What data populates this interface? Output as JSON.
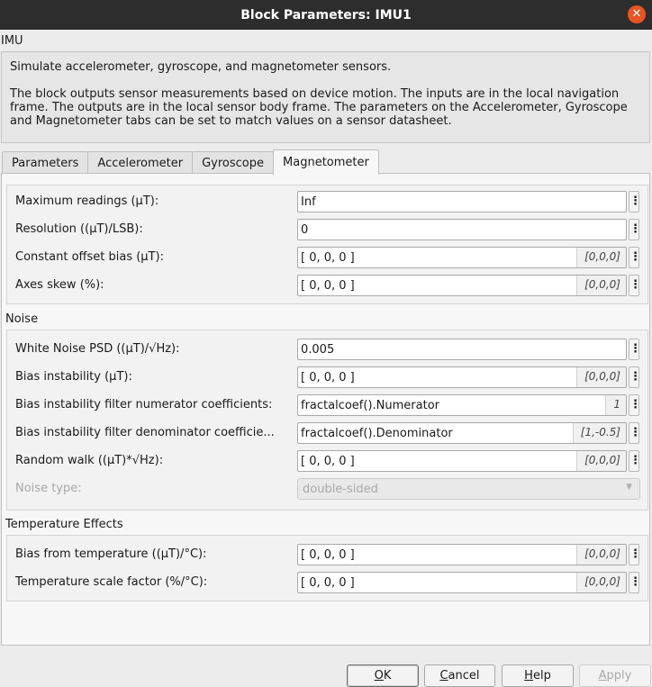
{
  "window": {
    "title": "Block Parameters: IMU1",
    "close_glyph": "✕"
  },
  "block_name": "IMU",
  "description": {
    "line1": "Simulate accelerometer, gyroscope, and magnetometer sensors.",
    "line2": "The block outputs sensor measurements based on device motion. The inputs are in the local navigation frame. The outputs are in the local sensor body frame. The parameters on the Accelerometer, Gyroscope and Magnetometer tabs can be set to match values on a sensor datasheet."
  },
  "tabs": [
    {
      "label": "Parameters"
    },
    {
      "label": "Accelerometer"
    },
    {
      "label": "Gyroscope"
    },
    {
      "label": "Magnetometer"
    }
  ],
  "sensor_group": {
    "max_readings": {
      "label": "Maximum readings (μT):",
      "value": "Inf"
    },
    "resolution": {
      "label": "Resolution ((μT)/LSB):",
      "value": "0"
    },
    "constant_offset": {
      "label": "Constant offset bias (μT):",
      "value": "[ 0, 0, 0 ]",
      "hint": "[0,0,0]"
    },
    "axes_skew": {
      "label": "Axes skew (%):",
      "value": "[ 0, 0, 0 ]",
      "hint": "[0,0,0]"
    }
  },
  "noise": {
    "title": "Noise",
    "white_noise": {
      "label": "White Noise PSD ((μT)/√Hz):",
      "value": "0.005"
    },
    "bias_instability": {
      "label": "Bias instability (μT):",
      "value": "[ 0, 0, 0 ]",
      "hint": "[0,0,0]"
    },
    "numerator": {
      "label": "Bias instability filter numerator coefficients:",
      "value": "fractalcoef().Numerator",
      "hint": "1"
    },
    "denominator": {
      "label": "Bias instability filter denominator coefficie...",
      "value": "fractalcoef().Denominator",
      "hint": "[1,-0.5]"
    },
    "random_walk": {
      "label": "Random walk ((μT)*√Hz):",
      "value": "[ 0, 0, 0 ]",
      "hint": "[0,0,0]"
    },
    "noise_type": {
      "label": "Noise type:",
      "value": "double-sided"
    }
  },
  "temperature": {
    "title": "Temperature Effects",
    "bias_from_temp": {
      "label": "Bias from temperature ((μT)/°C):",
      "value": "[ 0, 0, 0 ]",
      "hint": "[0,0,0]"
    },
    "scale_factor": {
      "label": "Temperature scale factor (%/°C):",
      "value": "[ 0, 0, 0 ]",
      "hint": "[0,0,0]"
    }
  },
  "more_glyph": "⋮",
  "buttons": {
    "ok_mnemonic": "O",
    "ok_rest": "K",
    "cancel_mnemonic": "C",
    "cancel_rest": "ancel",
    "help_mnemonic": "H",
    "help_rest": "elp",
    "apply_mnemonic": "A",
    "apply_rest": "pply"
  },
  "colors": {
    "titlebar": "#2d2d2d",
    "close_button": "#e95420"
  }
}
